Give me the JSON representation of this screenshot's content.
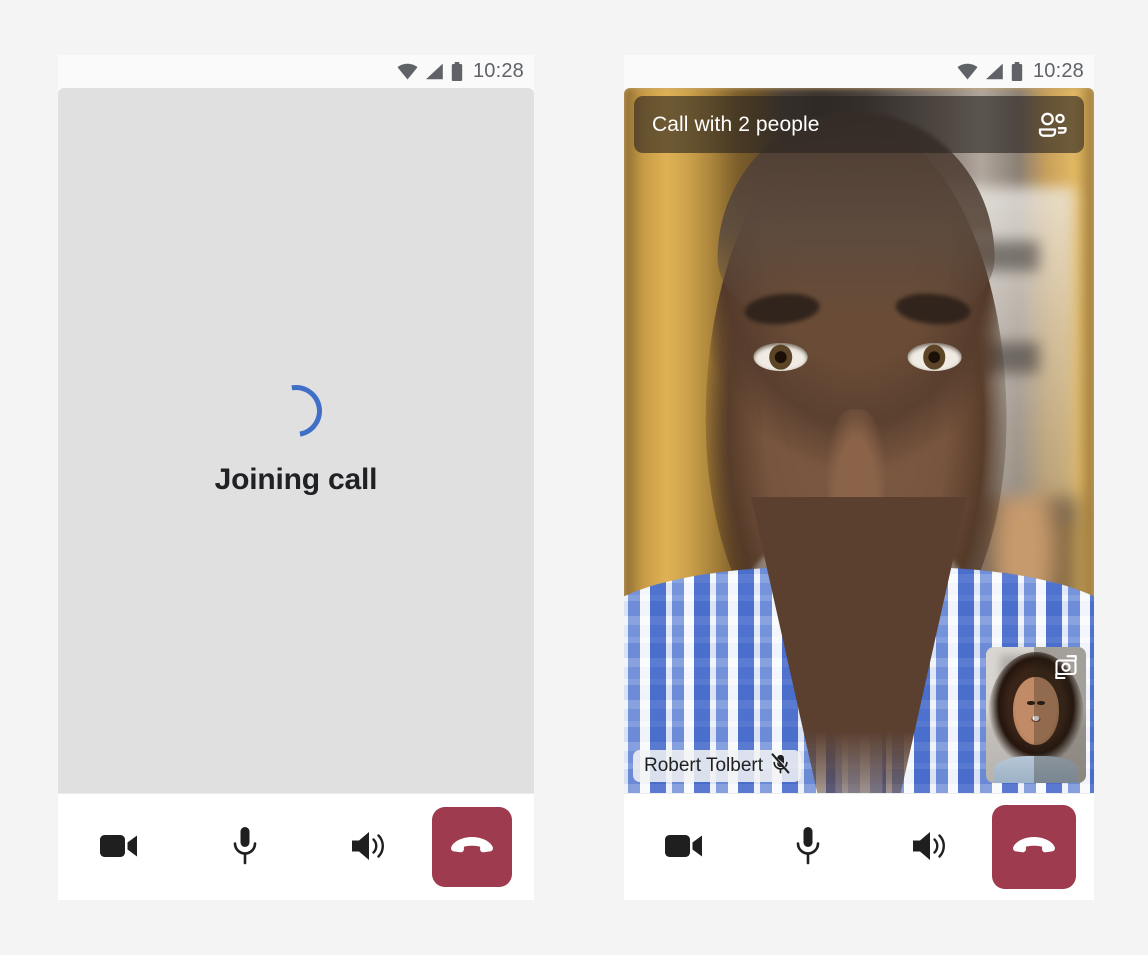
{
  "page": {
    "background_color": "#f4f4f4",
    "accent_blue": "#3f6fc6",
    "end_call_color": "#9e3b4f"
  },
  "phones": [
    {
      "id": "joining",
      "statusbar": {
        "wifi_icon": "wifi-icon",
        "signal_icon": "cellular-signal-icon",
        "battery_icon": "battery-icon",
        "time": "10:28"
      },
      "video": {
        "state": "placeholder",
        "spinner_icon": "loading-spinner-icon",
        "status_text": "Joining call"
      },
      "controls": {
        "video_label": "video-camera",
        "mic_label": "microphone",
        "speaker_label": "speaker",
        "end_call_label": "end-call"
      }
    },
    {
      "id": "in-call",
      "statusbar": {
        "wifi_icon": "wifi-icon",
        "signal_icon": "cellular-signal-icon",
        "battery_icon": "battery-icon",
        "time": "10:28"
      },
      "header": {
        "title": "Call with 2 people",
        "participants_icon": "people-icon"
      },
      "video": {
        "state": "live",
        "participant_name": "Robert Tolbert",
        "mute_icon": "microphone-muted-icon"
      },
      "selfview": {
        "flip_camera_icon": "flip-camera-icon"
      },
      "controls": {
        "video_label": "video-camera",
        "mic_label": "microphone",
        "speaker_label": "speaker",
        "end_call_label": "end-call"
      }
    }
  ]
}
